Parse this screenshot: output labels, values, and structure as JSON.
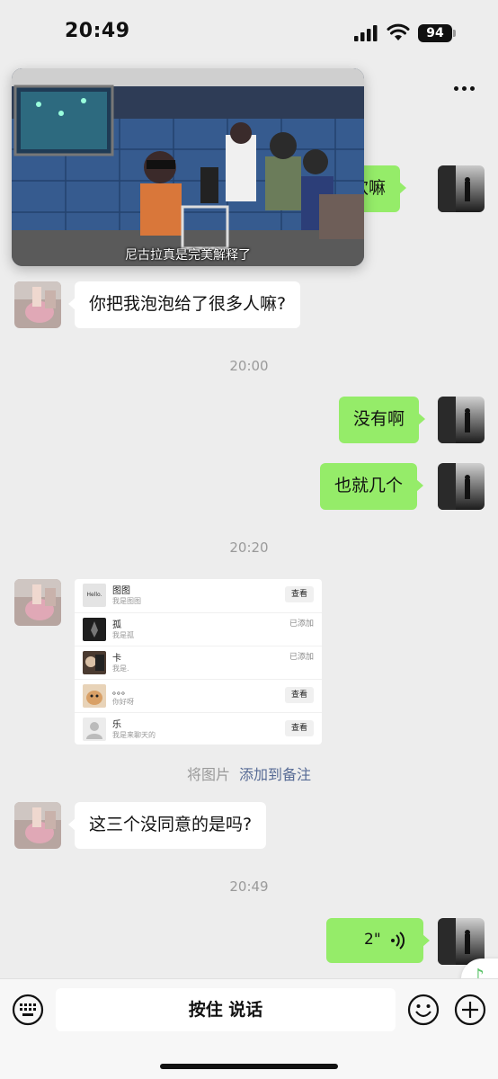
{
  "status_bar": {
    "time": "20:49",
    "battery": "94"
  },
  "video": {
    "subtitle": "尼古拉真是完美解释了"
  },
  "messages": {
    "partial_right": "喜欢嘛",
    "left_1": "你把我泡泡给了很多人嘛?",
    "time_1": "20:00",
    "right_1": "没有啊",
    "right_2": "也就几个",
    "time_2": "20:20",
    "left_2": "这三个没同意的是吗?",
    "time_3": "20:49",
    "voice_duration": "2\""
  },
  "contact_card": {
    "rows": [
      {
        "name": "图图",
        "sub": "我是图图",
        "action": "查看",
        "thumb": "Hello."
      },
      {
        "name": "孤",
        "sub": "我是孤",
        "action": "已添加"
      },
      {
        "name": "卡",
        "sub": "我是.",
        "action": "已添加"
      },
      {
        "name": "。。。",
        "sub": "你好呀",
        "action": "查看"
      },
      {
        "name": "乐",
        "sub": "我是来聊天的",
        "action": "查看"
      }
    ],
    "caption_prefix": "将图片",
    "caption_link": "添加到备注"
  },
  "input_bar": {
    "hold_to_talk": "按住 说话"
  },
  "icons": {
    "signal": "signal-icon",
    "wifi": "wifi-icon",
    "more": "more-icon",
    "keyboard": "keyboard-icon",
    "emoji": "emoji-icon",
    "plus": "plus-icon",
    "music": "music-note-icon",
    "voice": "voice-wave-icon"
  },
  "colors": {
    "bubble_right": "#95ec69",
    "bubble_left": "#ffffff",
    "link": "#576b95",
    "background": "#ededed"
  }
}
